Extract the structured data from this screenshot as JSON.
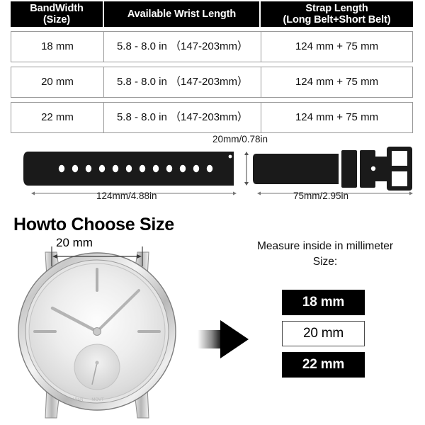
{
  "table": {
    "headers": [
      {
        "line1": "BandWidth",
        "line2": "(Size)"
      },
      {
        "line1": "Available Wrist Length",
        "line2": ""
      },
      {
        "line1": "Strap Length",
        "line2": "(Long Belt+Short Belt)"
      }
    ],
    "rows": [
      {
        "band_width": "18 mm",
        "wrist_length": "5.8 - 8.0 in （147-203mm）",
        "strap_length": "124 mm + 75 mm"
      },
      {
        "band_width": "20 mm",
        "wrist_length": "5.8 - 8.0 in （147-203mm）",
        "strap_length": "124 mm + 75 mm"
      },
      {
        "band_width": "22 mm",
        "wrist_length": "5.8 - 8.0 in （147-203mm）",
        "strap_length": "124 mm + 75 mm"
      }
    ]
  },
  "strap_diagram": {
    "width_label": "20mm/0.78in",
    "long_belt_label": "124mm/4.88in",
    "short_belt_label": "75mm/2.95in",
    "hole_count": 12,
    "strap_color": "#1a1a1a"
  },
  "bottom": {
    "title": "Howto Choose Size",
    "watch_lug_label": "20 mm",
    "measure_line1": "Measure inside in millimeter",
    "measure_line2": "Size:",
    "size_options": [
      {
        "label": "18 mm",
        "selected": false
      },
      {
        "label": "20 mm",
        "selected": true
      },
      {
        "label": "22 mm",
        "selected": false
      }
    ],
    "watch_dial_text_left": "JAPAN",
    "watch_dial_text_right": "MOVT",
    "pointer_color": "#e00000",
    "arrow_color": "#000000"
  }
}
